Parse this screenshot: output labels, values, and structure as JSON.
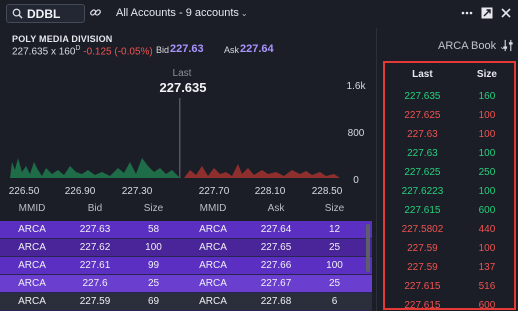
{
  "toolbar": {
    "symbol": "DDBL",
    "accounts_label": "All Accounts - 9 accounts",
    "caret": "⌄"
  },
  "header": {
    "instrument": "POLY MEDIA DIVISION",
    "last_price": "227.635",
    "size_prefix": "x",
    "size": "160",
    "size_marker": "D",
    "change": "-0.125 (-0.05%)",
    "bid_label": "Bid",
    "bid": "227.63",
    "ask_label": "Ask",
    "ask": "227.64",
    "book_select": "ARCA Book",
    "colors": {
      "bid_ask": "#a994ff",
      "negative": "#ef5350",
      "positive": "#26d07c"
    }
  },
  "chart": {
    "last_label": "Last",
    "last_value": "227.635"
  },
  "chart_data": {
    "type": "area",
    "x_ticks": [
      "226.50",
      "226.90",
      "227.30",
      "227.70",
      "228.10",
      "228.50"
    ],
    "y_ticks": [
      "1.6k",
      "800",
      "0"
    ],
    "last_marker": 227.635,
    "xlim": [
      226.4,
      228.8
    ],
    "ylim": [
      0,
      1800
    ]
  },
  "book": {
    "headers": [
      "MMID",
      "Bid",
      "Size",
      "MMID",
      "Ask",
      "Size"
    ],
    "rows": [
      {
        "bid_mmid": "ARCA",
        "bid": "227.63",
        "bid_size": "58",
        "ask_mmid": "ARCA",
        "ask": "227.64",
        "ask_size": "12"
      },
      {
        "bid_mmid": "ARCA",
        "bid": "227.62",
        "bid_size": "100",
        "ask_mmid": "ARCA",
        "ask": "227.65",
        "ask_size": "25"
      },
      {
        "bid_mmid": "ARCA",
        "bid": "227.61",
        "bid_size": "99",
        "ask_mmid": "ARCA",
        "ask": "227.66",
        "ask_size": "100"
      },
      {
        "bid_mmid": "ARCA",
        "bid": "227.6",
        "bid_size": "25",
        "ask_mmid": "ARCA",
        "ask": "227.67",
        "ask_size": "25"
      },
      {
        "bid_mmid": "ARCA",
        "bid": "227.59",
        "bid_size": "69",
        "ask_mmid": "ARCA",
        "ask": "227.68",
        "ask_size": "6"
      }
    ],
    "row_colors": [
      "#5a2fc2",
      "#4a2599",
      "#5a2fc2",
      "#6a3fcf",
      "#2b2f3b"
    ]
  },
  "time_and_sales": {
    "headers": [
      "Last",
      "Size"
    ],
    "rows": [
      {
        "last": "227.635",
        "size": "160",
        "dir": "up"
      },
      {
        "last": "227.625",
        "size": "100",
        "dir": "down"
      },
      {
        "last": "227.63",
        "size": "100",
        "dir": "down"
      },
      {
        "last": "227.63",
        "size": "100",
        "dir": "up"
      },
      {
        "last": "227.625",
        "size": "250",
        "dir": "up"
      },
      {
        "last": "227.6223",
        "size": "100",
        "dir": "up"
      },
      {
        "last": "227.615",
        "size": "600",
        "dir": "up"
      },
      {
        "last": "227.5802",
        "size": "440",
        "dir": "down"
      },
      {
        "last": "227.59",
        "size": "100",
        "dir": "down"
      },
      {
        "last": "227.59",
        "size": "137",
        "dir": "down"
      },
      {
        "last": "227.615",
        "size": "516",
        "dir": "down"
      },
      {
        "last": "227.615",
        "size": "600",
        "dir": "down"
      }
    ]
  }
}
